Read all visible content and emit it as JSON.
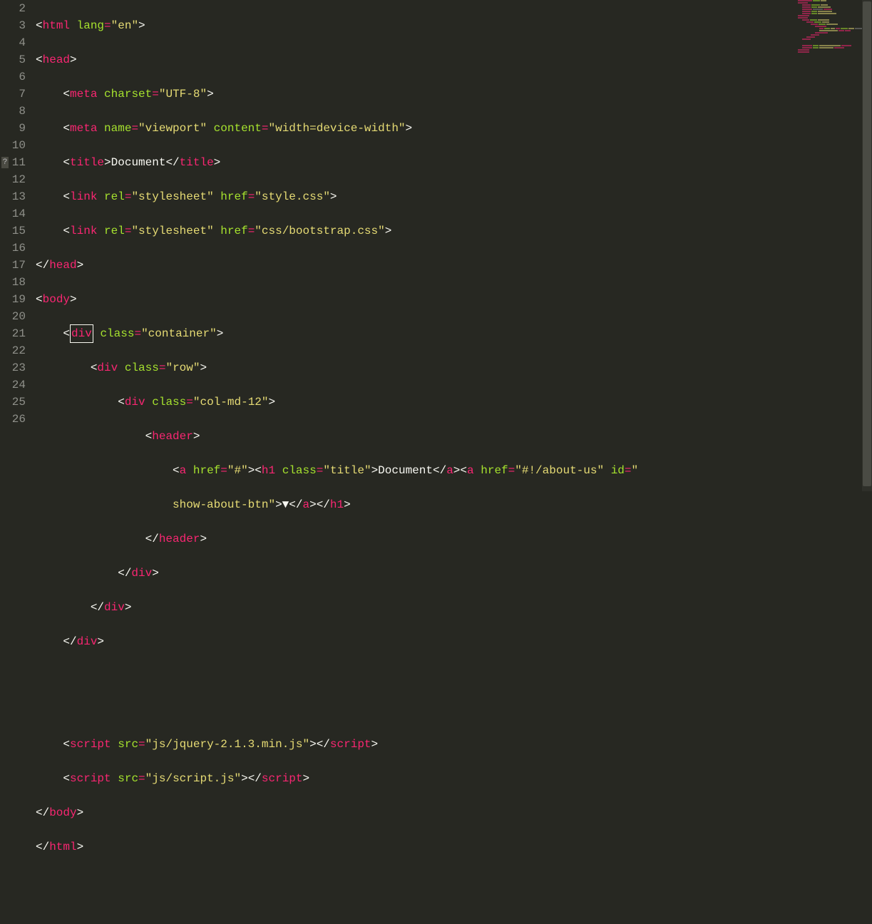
{
  "gutter": {
    "marker_line": 11,
    "marker_glyph": "?",
    "lines": [
      2,
      3,
      4,
      5,
      6,
      7,
      8,
      9,
      10,
      11,
      12,
      13,
      14,
      15,
      16,
      17,
      18,
      19,
      20,
      21,
      22,
      23,
      24,
      25,
      26
    ]
  },
  "code": {
    "l2": {
      "open": "<",
      "tag": "html",
      "attr": "lang",
      "eq": "=",
      "val": "\"en\"",
      "close": ">"
    },
    "l3": {
      "open": "<",
      "tag": "head",
      "close": ">"
    },
    "l4": {
      "open": "<",
      "tag": "meta",
      "attr": "charset",
      "eq": "=",
      "val": "\"UTF-8\"",
      "close": ">"
    },
    "l5": {
      "open": "<",
      "tag": "meta",
      "attr1": "name",
      "val1": "\"viewport\"",
      "attr2": "content",
      "val2": "\"width=device-width\"",
      "close": ">"
    },
    "l6": {
      "open": "<",
      "tag": "title",
      "close": ">",
      "text": "Document",
      "open2": "</",
      "tag2": "title",
      "close2": ">"
    },
    "l7": {
      "open": "<",
      "tag": "link",
      "attr1": "rel",
      "val1": "\"stylesheet\"",
      "attr2": "href",
      "val2": "\"style.css\"",
      "close": ">"
    },
    "l8": {
      "open": "<",
      "tag": "link",
      "attr1": "rel",
      "val1": "\"stylesheet\"",
      "attr2": "href",
      "val2": "\"css/bootstrap.css\"",
      "close": ">"
    },
    "l9": {
      "open": "</",
      "tag": "head",
      "close": ">"
    },
    "l10": {
      "open": "<",
      "tag": "body",
      "close": ">"
    },
    "l11": {
      "open": "<",
      "tag": "div",
      "attr": "class",
      "eq": "=",
      "val": "\"container\"",
      "close": ">"
    },
    "l12": {
      "open": "<",
      "tag": "div",
      "attr": "class",
      "eq": "=",
      "val": "\"row\"",
      "close": ">"
    },
    "l13": {
      "open": "<",
      "tag": "div",
      "attr": "class",
      "eq": "=",
      "val": "\"col-md-12\"",
      "close": ">"
    },
    "l14": {
      "open": "<",
      "tag": "header",
      "close": ">"
    },
    "l15a": {
      "open": "<",
      "tag": "a",
      "attr": "href",
      "eq": "=",
      "val": "\"#\"",
      "close": ">",
      "open2": "<",
      "tag2": "h1",
      "attr2": "class",
      "val2": "\"title\"",
      "close2": ">",
      "text": "Document",
      "open3": "</",
      "tag3": "a",
      "close3": ">",
      "open4": "<",
      "tag4": "a",
      "attr4": "href",
      "val4": "\"#!/about-us\"",
      "attr5": "id",
      "eq5": "=",
      "val5": "\""
    },
    "l15b": {
      "valcont": "show-about-btn\"",
      "close": ">",
      "text": "▼",
      "open2": "</",
      "tag2": "a",
      "close2": ">",
      "open3": "</",
      "tag3": "h1",
      "close3": ">"
    },
    "l16": {
      "open": "</",
      "tag": "header",
      "close": ">"
    },
    "l17": {
      "open": "</",
      "tag": "div",
      "close": ">"
    },
    "l18": {
      "open": "</",
      "tag": "div",
      "close": ">"
    },
    "l19": {
      "open": "</",
      "tag": "div",
      "close": ">"
    },
    "l22": {
      "open": "<",
      "tag": "script",
      "attr": "src",
      "eq": "=",
      "val": "\"js/jquery-2.1.3.min.js\"",
      "close": ">",
      "open2": "</",
      "tag2": "script",
      "close2": ">"
    },
    "l23": {
      "open": "<",
      "tag": "script",
      "attr": "src",
      "eq": "=",
      "val": "\"js/script.js\"",
      "close": ">",
      "open2": "</",
      "tag2": "script",
      "close2": ">"
    },
    "l24": {
      "open": "</",
      "tag": "body",
      "close": ">"
    },
    "l25": {
      "open": "</",
      "tag": "html",
      "close": ">"
    }
  }
}
